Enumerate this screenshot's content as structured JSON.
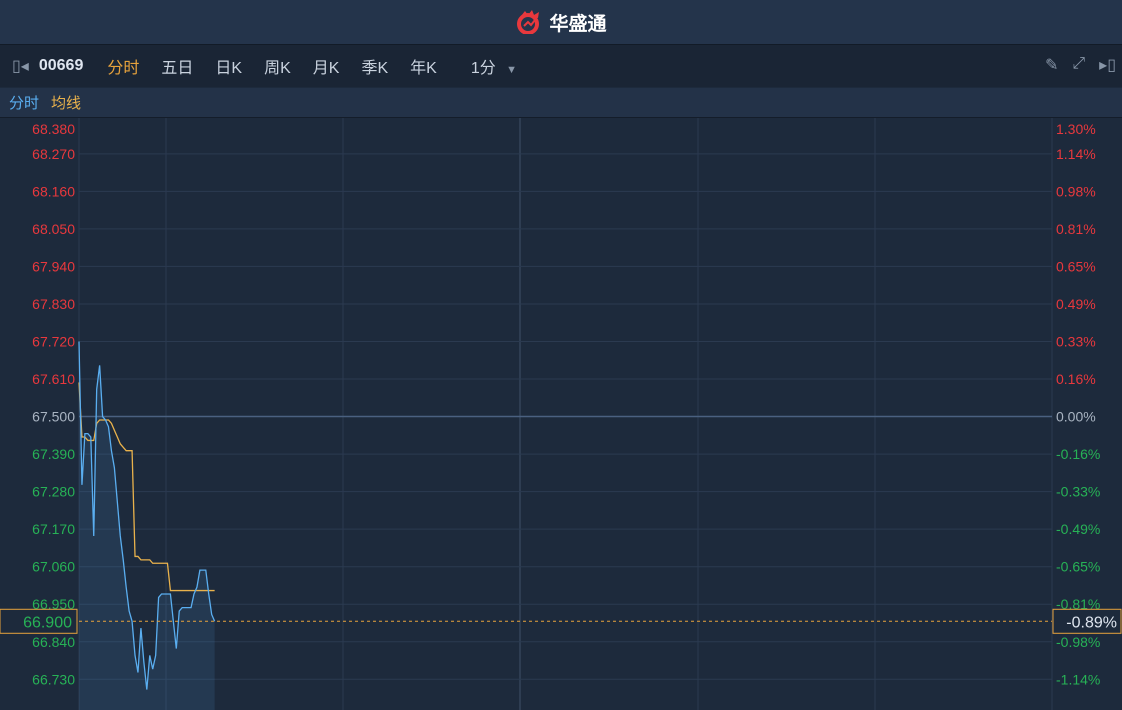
{
  "app": {
    "title": "华盛通"
  },
  "toolbar": {
    "code": "00669",
    "tabs": [
      "分时",
      "五日",
      "日K",
      "周K",
      "月K",
      "季K",
      "年K"
    ],
    "active_tab": "分时",
    "interval": "1分"
  },
  "legend": {
    "price_label": "分时",
    "avg_label": "均线"
  },
  "colors": {
    "up": "#e8383d",
    "down": "#27b256",
    "neutral": "#a9b4c2",
    "price_line": "#5aaef0",
    "avg_line": "#e9b24c",
    "accent": "#e8a33c"
  },
  "chart_data": {
    "type": "line",
    "ylim": [
      66.64,
      68.375
    ],
    "prev_close": 67.5,
    "minutes_total": 330,
    "y_ticks": [
      {
        "price": "68.380",
        "pct": "1.30%",
        "v": 68.38
      },
      {
        "price": "68.270",
        "pct": "1.14%",
        "v": 68.27
      },
      {
        "price": "68.160",
        "pct": "0.98%",
        "v": 68.16
      },
      {
        "price": "68.050",
        "pct": "0.81%",
        "v": 68.05
      },
      {
        "price": "67.940",
        "pct": "0.65%",
        "v": 67.94
      },
      {
        "price": "67.830",
        "pct": "0.49%",
        "v": 67.83
      },
      {
        "price": "67.720",
        "pct": "0.33%",
        "v": 67.72
      },
      {
        "price": "67.610",
        "pct": "0.16%",
        "v": 67.61
      },
      {
        "price": "67.500",
        "pct": "0.00%",
        "v": 67.5
      },
      {
        "price": "67.390",
        "pct": "-0.16%",
        "v": 67.39
      },
      {
        "price": "67.280",
        "pct": "-0.33%",
        "v": 67.28
      },
      {
        "price": "67.170",
        "pct": "-0.49%",
        "v": 67.17
      },
      {
        "price": "67.060",
        "pct": "-0.65%",
        "v": 67.06
      },
      {
        "price": "66.950",
        "pct": "-0.81%",
        "v": 66.95
      },
      {
        "price": "66.840",
        "pct": "-0.98%",
        "v": 66.84
      },
      {
        "price": "66.730",
        "pct": "-1.14%",
        "v": 66.73
      }
    ],
    "series": [
      {
        "name": "分时",
        "values": [
          67.72,
          67.3,
          67.45,
          67.45,
          67.44,
          67.15,
          67.58,
          67.65,
          67.5,
          67.49,
          67.47,
          67.4,
          67.35,
          67.25,
          67.15,
          67.08,
          67.0,
          66.93,
          66.9,
          66.8,
          66.75,
          66.88,
          66.78,
          66.7,
          66.8,
          66.76,
          66.8,
          66.97,
          66.98,
          66.98,
          66.98,
          66.98,
          66.9,
          66.82,
          66.93,
          66.94,
          66.94,
          66.94,
          66.94,
          66.98,
          67.0,
          67.05,
          67.05,
          67.05,
          66.98,
          66.92,
          66.9
        ]
      },
      {
        "name": "均线",
        "values": [
          67.6,
          67.44,
          67.44,
          67.43,
          67.43,
          67.43,
          67.48,
          67.49,
          67.49,
          67.49,
          67.49,
          67.48,
          67.46,
          67.44,
          67.42,
          67.41,
          67.4,
          67.4,
          67.4,
          67.09,
          67.09,
          67.08,
          67.08,
          67.08,
          67.08,
          67.07,
          67.07,
          67.07,
          67.07,
          67.07,
          67.07,
          66.99,
          66.99,
          66.99,
          66.99,
          66.99,
          66.99,
          66.99,
          66.99,
          66.99,
          66.99,
          66.99,
          66.99,
          66.99,
          66.99,
          66.99,
          66.99
        ]
      }
    ],
    "last": {
      "price": "66.900",
      "pct": "-0.89%",
      "v": 66.9
    }
  }
}
